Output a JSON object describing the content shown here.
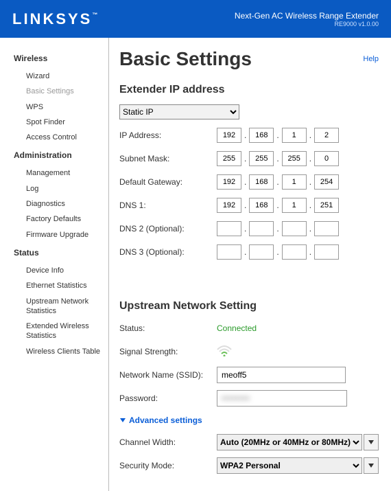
{
  "header": {
    "logo": "LINKSYS",
    "product": "Next-Gen AC Wireless Range Extender",
    "version": "RE9000 v1.0.00"
  },
  "sidebar": {
    "sections": [
      {
        "title": "Wireless",
        "items": [
          "Wizard",
          "Basic Settings",
          "WPS",
          "Spot Finder",
          "Access Control"
        ],
        "active_index": 1
      },
      {
        "title": "Administration",
        "items": [
          "Management",
          "Log",
          "Diagnostics",
          "Factory Defaults",
          "Firmware Upgrade"
        ],
        "active_index": -1
      },
      {
        "title": "Status",
        "items": [
          "Device Info",
          "Ethernet Statistics",
          "Upstream Network Statistics",
          "Extended Wireless Statistics",
          "Wireless Clients Table"
        ],
        "active_index": -1
      }
    ]
  },
  "main": {
    "title": "Basic Settings",
    "help": "Help",
    "sections": {
      "ip": {
        "heading": "Extender IP address",
        "mode_label": "Static IP",
        "rows": [
          {
            "label": "IP Address:",
            "octets": [
              "192",
              "168",
              "1",
              "2"
            ]
          },
          {
            "label": "Subnet Mask:",
            "octets": [
              "255",
              "255",
              "255",
              "0"
            ]
          },
          {
            "label": "Default Gateway:",
            "octets": [
              "192",
              "168",
              "1",
              "254"
            ]
          },
          {
            "label": "DNS 1:",
            "octets": [
              "192",
              "168",
              "1",
              "251"
            ]
          },
          {
            "label": "DNS 2 (Optional):",
            "octets": [
              "",
              "",
              "",
              ""
            ]
          },
          {
            "label": "DNS 3 (Optional):",
            "octets": [
              "",
              "",
              "",
              ""
            ]
          }
        ]
      },
      "upstream": {
        "heading": "Upstream Network Setting",
        "status_label": "Status:",
        "status_value": "Connected",
        "signal_label": "Signal Strength:",
        "signal_bars": 2,
        "ssid_label": "Network Name (SSID):",
        "ssid_value": "meoff5",
        "password_label": "Password:",
        "password_value": "••••••••",
        "advanced_label": "Advanced settings",
        "channel_label": "Channel Width:",
        "channel_value": "Auto (20MHz or 40MHz or 80MHz)",
        "security_label": "Security Mode:",
        "security_value": "WPA2 Personal"
      }
    }
  }
}
